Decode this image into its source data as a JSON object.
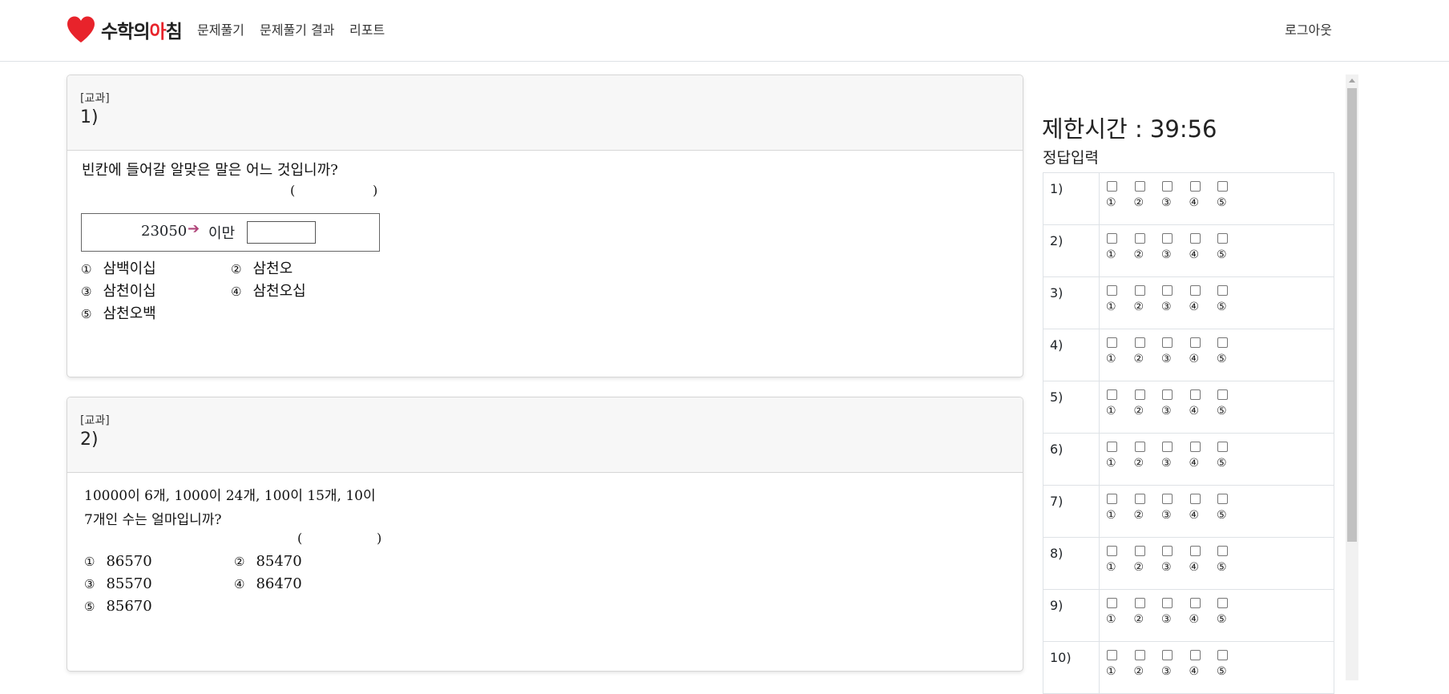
{
  "nav": {
    "logo": {
      "text_a": "수학의",
      "text_b": "아",
      "text_c": "침"
    },
    "links": [
      "문제풀기",
      "문제풀기 결과",
      "리포트"
    ],
    "logout": "로그아웃"
  },
  "questions": [
    {
      "type": "[교과]",
      "number": "1)",
      "stem": "빈칸에 들어갈 알맞은 말은 어느 것입니까?",
      "paren_open": "(",
      "paren_close": ")",
      "box": {
        "number": "23050",
        "arrow": "➔",
        "label": "이만"
      },
      "choices": [
        {
          "mark": "①",
          "text": "삼백이십"
        },
        {
          "mark": "②",
          "text": "삼천오"
        },
        {
          "mark": "③",
          "text": "삼천이십"
        },
        {
          "mark": "④",
          "text": "삼천오십"
        },
        {
          "mark": "⑤",
          "text": "삼천오백"
        }
      ]
    },
    {
      "type": "[교과]",
      "number": "2)",
      "stem_line1": "10000이 6개, 1000이 24개, 100이 15개, 10이",
      "stem_line2": "7개인 수는 얼마입니까?",
      "paren_open": "(",
      "paren_close": ")",
      "choices": [
        {
          "mark": "①",
          "text": "86570"
        },
        {
          "mark": "②",
          "text": "85470"
        },
        {
          "mark": "③",
          "text": "85570"
        },
        {
          "mark": "④",
          "text": "86470"
        },
        {
          "mark": "⑤",
          "text": "85670"
        }
      ]
    }
  ],
  "timer": "제한시간 : 39:56",
  "answer_title": "정답입력",
  "answer_rows": [
    "1)",
    "2)",
    "3)",
    "4)",
    "5)",
    "6)",
    "7)",
    "8)",
    "9)",
    "10)"
  ],
  "option_labels": [
    "①",
    "②",
    "③",
    "④",
    "⑤"
  ],
  "colors": {
    "logo_heart": "#e8232b",
    "arrow": "#b0457a"
  }
}
